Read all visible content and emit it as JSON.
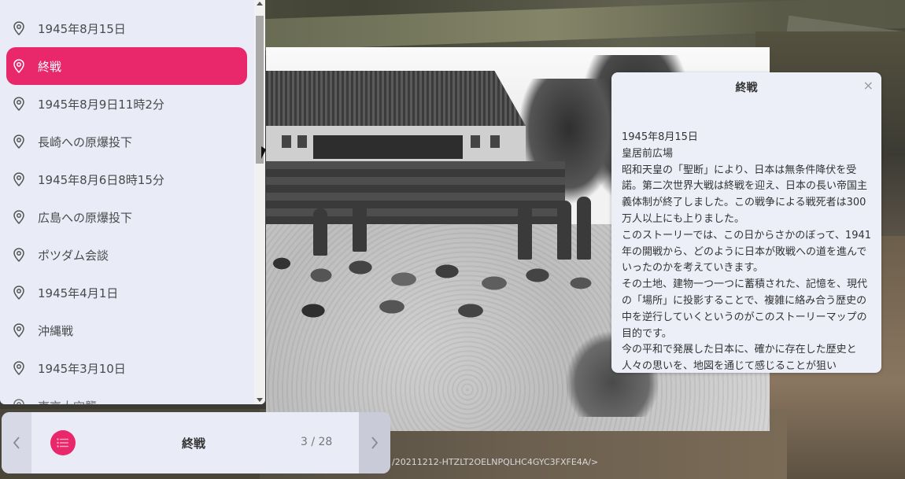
{
  "list": {
    "items": [
      {
        "label": "1945年8月15日",
        "active": false
      },
      {
        "label": "終戦",
        "active": true
      },
      {
        "label": "1945年8月9日11時2分",
        "active": false
      },
      {
        "label": "長崎への原爆投下",
        "active": false
      },
      {
        "label": "1945年8月6日8時15分",
        "active": false
      },
      {
        "label": "広島への原爆投下",
        "active": false
      },
      {
        "label": "ポツダム会談",
        "active": false
      },
      {
        "label": "1945年4月1日",
        "active": false
      },
      {
        "label": "沖縄戦",
        "active": false
      },
      {
        "label": "1945年3月10日",
        "active": false
      },
      {
        "label": "東京大空襲",
        "active": false
      }
    ]
  },
  "navbar": {
    "title": "終戦",
    "page": "3 / 28",
    "prev_icon": "chevron-left-icon",
    "next_icon": "chevron-right-icon",
    "menu_icon": "list-icon"
  },
  "popup": {
    "title": "終戦",
    "close_icon": "×",
    "lines": [
      "1945年8月15日",
      "皇居前広場",
      "昭和天皇の「聖断」により、日本は無条件降伏を受諾。第二次世界大戦は終戦を迎え、日本の長い帝国主義体制が終了しました。この戦争による戦死者は300万人以上にも上りました。",
      "このストーリーでは、この日からさかのぼって、1941年の開戦から、どのように日本が敗戦への道を進んでいったのかを考えていきます。",
      "その土地、建物一つ一つに蓄積された、記憶を、現代の「場所」に投影することで、複雑に絡み合う歴史の中を逆行していくというのがこのストーリーマップの目的です。",
      "今の平和で発展した日本に、確かに存在した歴史と人々の思いを、地図を通じて感じることが狙い"
    ]
  },
  "url": "/20211212-HTZLT2OELNPQLHC4GYC3FXFE4A/>",
  "colors": {
    "accent": "#e8286b",
    "panel": "#e9ebf7"
  }
}
